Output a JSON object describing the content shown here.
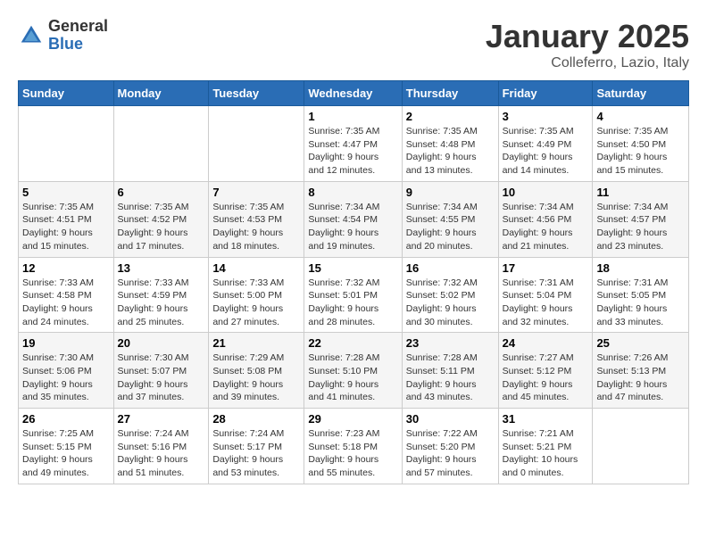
{
  "logo": {
    "general": "General",
    "blue": "Blue"
  },
  "title": "January 2025",
  "location": "Colleferro, Lazio, Italy",
  "days_of_week": [
    "Sunday",
    "Monday",
    "Tuesday",
    "Wednesday",
    "Thursday",
    "Friday",
    "Saturday"
  ],
  "weeks": [
    [
      {
        "day": "",
        "info": ""
      },
      {
        "day": "",
        "info": ""
      },
      {
        "day": "",
        "info": ""
      },
      {
        "day": "1",
        "info": "Sunrise: 7:35 AM\nSunset: 4:47 PM\nDaylight: 9 hours\nand 12 minutes."
      },
      {
        "day": "2",
        "info": "Sunrise: 7:35 AM\nSunset: 4:48 PM\nDaylight: 9 hours\nand 13 minutes."
      },
      {
        "day": "3",
        "info": "Sunrise: 7:35 AM\nSunset: 4:49 PM\nDaylight: 9 hours\nand 14 minutes."
      },
      {
        "day": "4",
        "info": "Sunrise: 7:35 AM\nSunset: 4:50 PM\nDaylight: 9 hours\nand 15 minutes."
      }
    ],
    [
      {
        "day": "5",
        "info": "Sunrise: 7:35 AM\nSunset: 4:51 PM\nDaylight: 9 hours\nand 15 minutes."
      },
      {
        "day": "6",
        "info": "Sunrise: 7:35 AM\nSunset: 4:52 PM\nDaylight: 9 hours\nand 17 minutes."
      },
      {
        "day": "7",
        "info": "Sunrise: 7:35 AM\nSunset: 4:53 PM\nDaylight: 9 hours\nand 18 minutes."
      },
      {
        "day": "8",
        "info": "Sunrise: 7:34 AM\nSunset: 4:54 PM\nDaylight: 9 hours\nand 19 minutes."
      },
      {
        "day": "9",
        "info": "Sunrise: 7:34 AM\nSunset: 4:55 PM\nDaylight: 9 hours\nand 20 minutes."
      },
      {
        "day": "10",
        "info": "Sunrise: 7:34 AM\nSunset: 4:56 PM\nDaylight: 9 hours\nand 21 minutes."
      },
      {
        "day": "11",
        "info": "Sunrise: 7:34 AM\nSunset: 4:57 PM\nDaylight: 9 hours\nand 23 minutes."
      }
    ],
    [
      {
        "day": "12",
        "info": "Sunrise: 7:33 AM\nSunset: 4:58 PM\nDaylight: 9 hours\nand 24 minutes."
      },
      {
        "day": "13",
        "info": "Sunrise: 7:33 AM\nSunset: 4:59 PM\nDaylight: 9 hours\nand 25 minutes."
      },
      {
        "day": "14",
        "info": "Sunrise: 7:33 AM\nSunset: 5:00 PM\nDaylight: 9 hours\nand 27 minutes."
      },
      {
        "day": "15",
        "info": "Sunrise: 7:32 AM\nSunset: 5:01 PM\nDaylight: 9 hours\nand 28 minutes."
      },
      {
        "day": "16",
        "info": "Sunrise: 7:32 AM\nSunset: 5:02 PM\nDaylight: 9 hours\nand 30 minutes."
      },
      {
        "day": "17",
        "info": "Sunrise: 7:31 AM\nSunset: 5:04 PM\nDaylight: 9 hours\nand 32 minutes."
      },
      {
        "day": "18",
        "info": "Sunrise: 7:31 AM\nSunset: 5:05 PM\nDaylight: 9 hours\nand 33 minutes."
      }
    ],
    [
      {
        "day": "19",
        "info": "Sunrise: 7:30 AM\nSunset: 5:06 PM\nDaylight: 9 hours\nand 35 minutes."
      },
      {
        "day": "20",
        "info": "Sunrise: 7:30 AM\nSunset: 5:07 PM\nDaylight: 9 hours\nand 37 minutes."
      },
      {
        "day": "21",
        "info": "Sunrise: 7:29 AM\nSunset: 5:08 PM\nDaylight: 9 hours\nand 39 minutes."
      },
      {
        "day": "22",
        "info": "Sunrise: 7:28 AM\nSunset: 5:10 PM\nDaylight: 9 hours\nand 41 minutes."
      },
      {
        "day": "23",
        "info": "Sunrise: 7:28 AM\nSunset: 5:11 PM\nDaylight: 9 hours\nand 43 minutes."
      },
      {
        "day": "24",
        "info": "Sunrise: 7:27 AM\nSunset: 5:12 PM\nDaylight: 9 hours\nand 45 minutes."
      },
      {
        "day": "25",
        "info": "Sunrise: 7:26 AM\nSunset: 5:13 PM\nDaylight: 9 hours\nand 47 minutes."
      }
    ],
    [
      {
        "day": "26",
        "info": "Sunrise: 7:25 AM\nSunset: 5:15 PM\nDaylight: 9 hours\nand 49 minutes."
      },
      {
        "day": "27",
        "info": "Sunrise: 7:24 AM\nSunset: 5:16 PM\nDaylight: 9 hours\nand 51 minutes."
      },
      {
        "day": "28",
        "info": "Sunrise: 7:24 AM\nSunset: 5:17 PM\nDaylight: 9 hours\nand 53 minutes."
      },
      {
        "day": "29",
        "info": "Sunrise: 7:23 AM\nSunset: 5:18 PM\nDaylight: 9 hours\nand 55 minutes."
      },
      {
        "day": "30",
        "info": "Sunrise: 7:22 AM\nSunset: 5:20 PM\nDaylight: 9 hours\nand 57 minutes."
      },
      {
        "day": "31",
        "info": "Sunrise: 7:21 AM\nSunset: 5:21 PM\nDaylight: 10 hours\nand 0 minutes."
      },
      {
        "day": "",
        "info": ""
      }
    ]
  ]
}
